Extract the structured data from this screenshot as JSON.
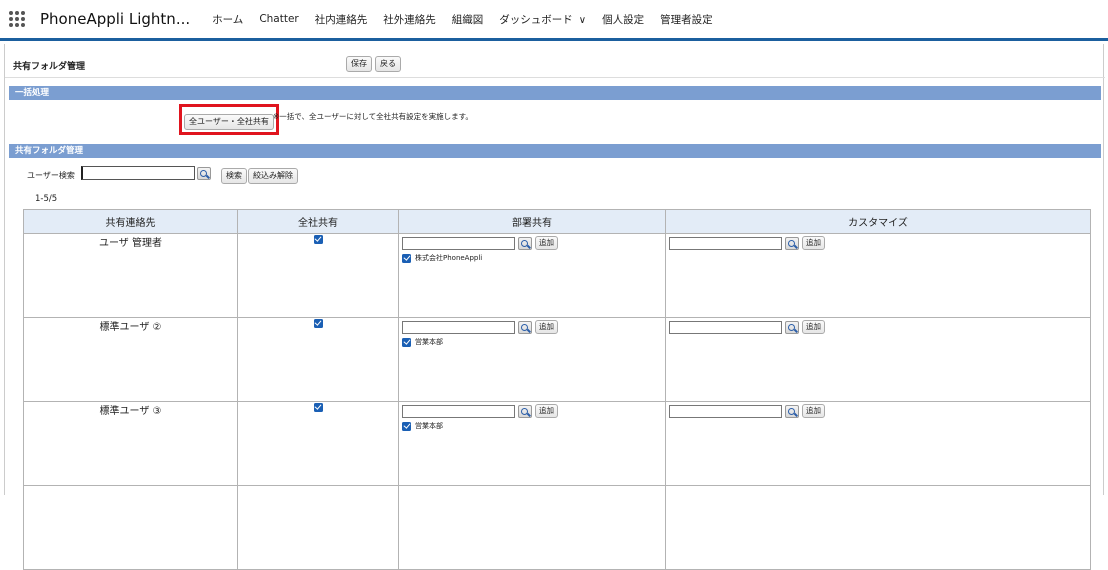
{
  "app": {
    "name": "PhoneAppli Lightn...",
    "nav": [
      {
        "label": "ホーム"
      },
      {
        "label": "Chatter"
      },
      {
        "label": "社内連絡先"
      },
      {
        "label": "社外連絡先"
      },
      {
        "label": "組織図"
      },
      {
        "label": "ダッシュボード"
      },
      {
        "label": "個人設定"
      },
      {
        "label": "管理者設定"
      }
    ]
  },
  "page": {
    "title": "共有フォルダ管理",
    "save_label": "保存",
    "back_label": "戻る"
  },
  "bulk": {
    "section_title": "一括処理",
    "button_label": "全ユーザー・全社共有",
    "note": "※一括で、全ユーザーに対して全社共有設定を実施します。"
  },
  "manage": {
    "section_title": "共有フォルダ管理",
    "search_label": "ユーザー検索",
    "search_value": "",
    "search_button": "検索",
    "clear_button": "絞込み解除",
    "count": "1-5/5",
    "columns": [
      "共有連絡先",
      "全社共有",
      "部署共有",
      "カスタマイズ"
    ],
    "add_label": "追加",
    "rows": [
      {
        "name": "ユーザ 管理者",
        "company_share": true,
        "dept": "株式会社PhoneAppli"
      },
      {
        "name": "標準ユーザ ②",
        "company_share": true,
        "dept": "営業本部"
      },
      {
        "name": "標準ユーザ ③",
        "company_share": true,
        "dept": "営業本部"
      }
    ]
  },
  "colors": {
    "section_bar": "#7b9ed1",
    "header_bg": "#e3ecf7",
    "highlight": "#e0141e",
    "checkbox": "#1a5fb4",
    "topbar_border": "#1b5f9e"
  },
  "icons": [
    "app-launcher-icon",
    "chevron-down-icon",
    "lookup-icon",
    "checkbox-icon"
  ]
}
